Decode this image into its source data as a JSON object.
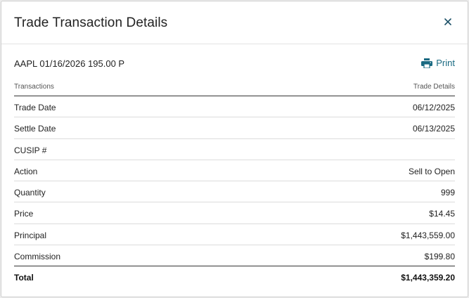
{
  "modal": {
    "title": "Trade Transaction Details",
    "close_icon": "close-icon"
  },
  "security": "AAPL 01/16/2026 195.00 P",
  "print": {
    "label": "Print",
    "icon": "printer-icon",
    "color": "#1a6a82"
  },
  "table": {
    "headers": {
      "left": "Transactions",
      "right": "Trade Details"
    },
    "rows": [
      {
        "label": "Trade Date",
        "value": "06/12/2025"
      },
      {
        "label": "Settle Date",
        "value": "06/13/2025"
      },
      {
        "label": "CUSIP #",
        "value": ""
      },
      {
        "label": "Action",
        "value": "Sell to Open"
      },
      {
        "label": "Quantity",
        "value": "999"
      },
      {
        "label": "Price",
        "value": "$14.45"
      },
      {
        "label": "Principal",
        "value": "$1,443,559.00"
      },
      {
        "label": "Commission",
        "value": "$199.80"
      }
    ],
    "total": {
      "label": "Total",
      "value": "$1,443,359.20"
    }
  }
}
